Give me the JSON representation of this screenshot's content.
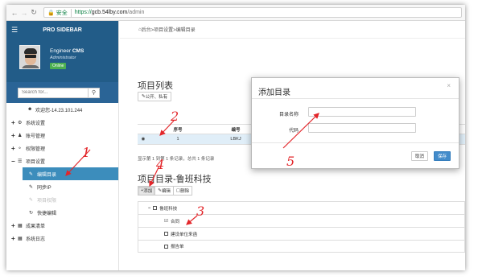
{
  "browser": {
    "secure_label": "安全",
    "url_proto": "https://",
    "url_host": "gcb.54lby.com",
    "url_path": "/admin"
  },
  "sidebar": {
    "title": "PRO SIDEBAR",
    "user": {
      "name": "Engineer",
      "name_bold": "CMS",
      "role": "Administrator",
      "status": "Online"
    },
    "search_placeholder": "Search for...",
    "items": [
      {
        "label": "欢迎您-14.23.101.244",
        "icon": "user-icon"
      },
      {
        "label": "系统设置",
        "icon": "cogs-icon",
        "expander": "+"
      },
      {
        "label": "账号管理",
        "icon": "users-icon",
        "expander": "+"
      },
      {
        "label": "权限管理",
        "icon": "shield-icon",
        "expander": "+"
      },
      {
        "label": "项目设置",
        "icon": "list-icon",
        "expander": "−"
      },
      {
        "label": "编辑目录",
        "icon": "edit-icon",
        "active": true
      },
      {
        "label": "同步IP",
        "icon": "edit-icon"
      },
      {
        "label": "项目权限",
        "icon": "edit-icon",
        "disabled": true
      },
      {
        "label": "快捷编辑",
        "icon": "refresh-icon"
      },
      {
        "label": "成果清单",
        "icon": "table-icon",
        "expander": "+"
      },
      {
        "label": "系统日志",
        "icon": "table-icon",
        "expander": "+"
      }
    ]
  },
  "main": {
    "breadcrumb": "后台>项目设置>编辑目录",
    "list_title": "项目列表",
    "public_button": "公开、私有",
    "table": {
      "headers": [
        "序号",
        "编号"
      ],
      "rows": [
        {
          "index": "1",
          "code": "LBKJ"
        }
      ]
    },
    "pager_text": "显示第 1 到第 1 条记录，总共 1 条记录",
    "dir_title": "项目目录-鲁班科技",
    "toolbar": {
      "add": "添加",
      "edit": "编辑",
      "delete": "删除"
    },
    "tree": {
      "root": "鲁班科技",
      "children": [
        "合同",
        "建设单位来函",
        "报告单"
      ]
    }
  },
  "modal": {
    "title": "添加目录",
    "close": "×",
    "field_name_label": "目录名称",
    "field_code_label": "代码",
    "field_name_value": "",
    "field_code_value": "",
    "cancel": "取消",
    "save": "保存"
  },
  "annotations": {
    "color": "#e3262a",
    "numbers": [
      "1",
      "2",
      "3",
      "4",
      "5"
    ]
  }
}
